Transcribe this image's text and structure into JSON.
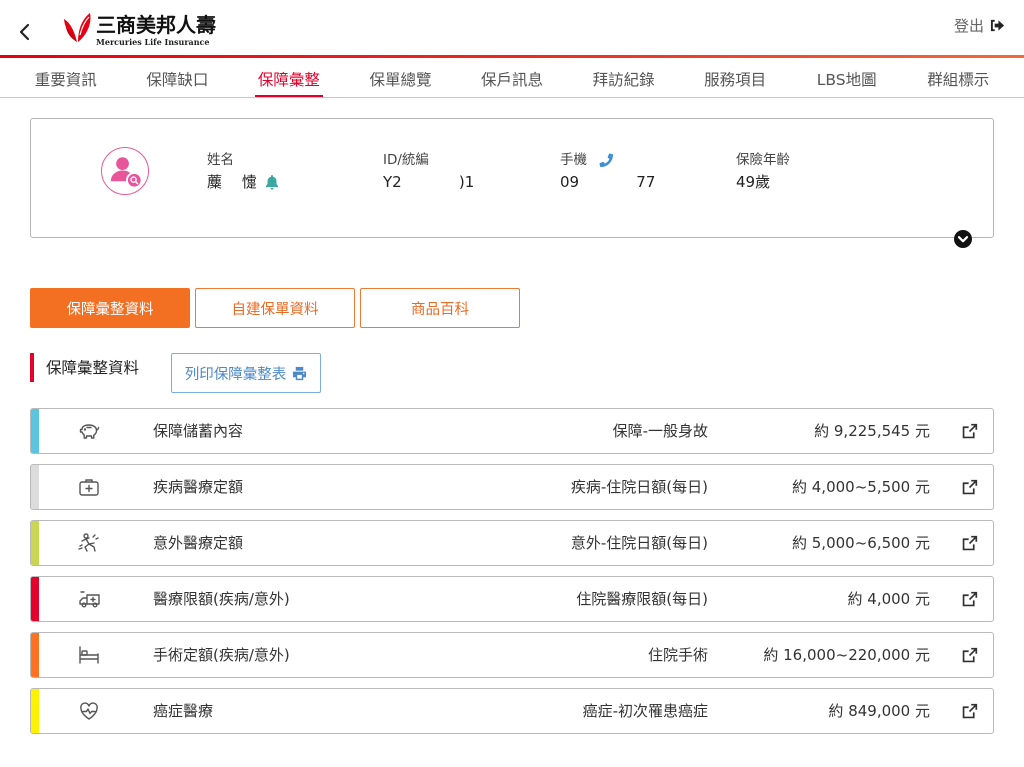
{
  "header": {
    "back_icon": "chevron-left-icon",
    "logo_icon": "butterfly-logo-icon",
    "logo_name": "三商美邦人壽",
    "logo_subtitle": "Mercuries Life Insurance",
    "logout_label": "登出",
    "logout_icon": "sign-out-icon"
  },
  "nav": {
    "active_index": 2,
    "tabs": [
      {
        "label": "重要資訊"
      },
      {
        "label": "保障缺口"
      },
      {
        "label": "保障彙整"
      },
      {
        "label": "保單總覽"
      },
      {
        "label": "保戶訊息"
      },
      {
        "label": "拜訪紀錄"
      },
      {
        "label": "服務項目"
      },
      {
        "label": "LBS地圖"
      },
      {
        "label": "群組標示"
      }
    ]
  },
  "profile": {
    "avatar_icon": "user-search-icon",
    "name": {
      "label": "姓名",
      "value": "蘪　 懥",
      "icon": "bell-icon"
    },
    "id": {
      "label": "ID/統編",
      "value": "Y2            )1"
    },
    "mobile": {
      "label": "手機",
      "value": "09            77",
      "icon": "phone-icon"
    },
    "age": {
      "label": "保險年齡",
      "value": "49歲"
    },
    "expand_icon": "chevron-circle-down-icon"
  },
  "action_tabs": [
    {
      "label": "保障彙整資料",
      "active": true
    },
    {
      "label": "自建保單資料",
      "active": false
    },
    {
      "label": "商品百科",
      "active": false
    }
  ],
  "section": {
    "title": "保障彙整資料",
    "print_label": "列印保障彙整表",
    "print_icon": "print-icon"
  },
  "coverage_rows": [
    {
      "icon": "piggy-bank-icon",
      "label": "保障儲蓄內容",
      "category": "保障-一般身故",
      "amount": "約 9,225,545 元",
      "color": "#5bc4de"
    },
    {
      "icon": "medkit-icon",
      "label": "疾病醫療定額",
      "category": "疾病-住院日額(每日)",
      "amount": "約 4,000~5,500 元",
      "color": "#dcdcdc"
    },
    {
      "icon": "accident-icon",
      "label": "意外醫療定額",
      "category": "意外-住院日額(每日)",
      "amount": "約 5,000~6,500 元",
      "color": "#c9d653"
    },
    {
      "icon": "ambulance-icon",
      "label": "醫療限額(疾病/意外)",
      "category": "住院醫療限額(每日)",
      "amount": "約 4,000 元",
      "color": "#e4002b"
    },
    {
      "icon": "hospital-bed-icon",
      "label": "手術定額(疾病/意外)",
      "category": "住院手術",
      "amount": "約 16,000~220,000 元",
      "color": "#ff7122"
    },
    {
      "icon": "heartbeat-icon",
      "label": "癌症醫療",
      "category": "癌症-初次罹患癌症",
      "amount": "約 849,000 元",
      "color": "#fff200"
    }
  ],
  "colors": {
    "brand_red": "#e4002b",
    "accent_orange": "#f36f21",
    "print_blue": "#4c88c8",
    "avatar_pink": "#e75a97"
  }
}
